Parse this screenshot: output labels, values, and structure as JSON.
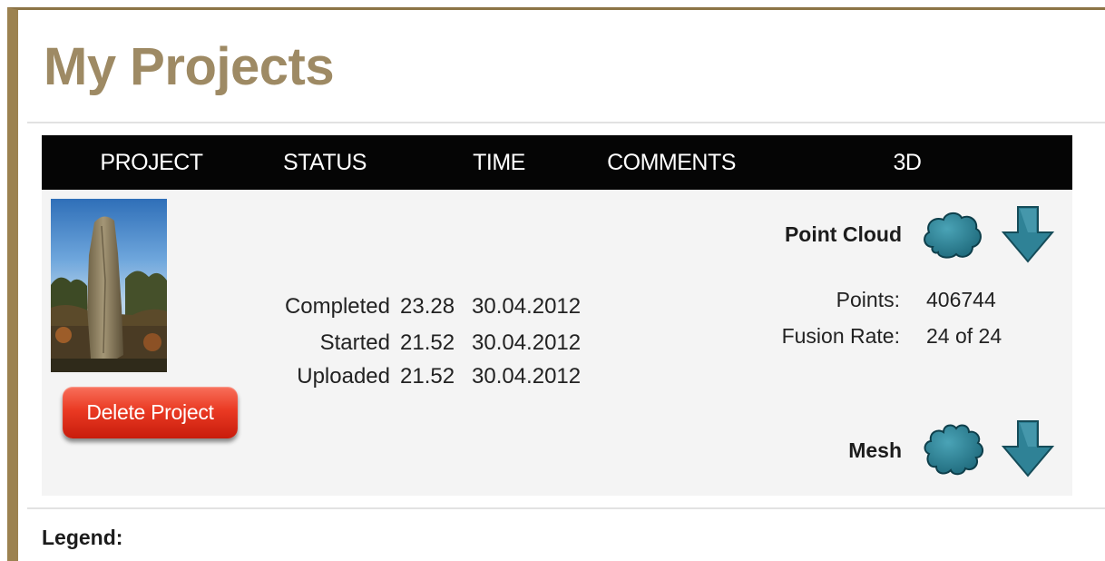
{
  "page": {
    "title": "My Projects",
    "legend_label": "Legend:"
  },
  "table": {
    "columns": [
      "PROJECT",
      "STATUS",
      "TIME",
      "COMMENTS",
      "3D"
    ]
  },
  "project": {
    "delete_label": "Delete Project",
    "status": [
      {
        "label": "Completed",
        "time": "23.28",
        "date": "30.04.2012"
      },
      {
        "label": "Started",
        "time": "21.52",
        "date": "30.04.2012"
      },
      {
        "label": "Uploaded",
        "time": "21.52",
        "date": "30.04.2012"
      }
    ],
    "point_cloud": {
      "label": "Point Cloud",
      "points_label": "Points:",
      "points_value": "406744",
      "fusion_label": "Fusion Rate:",
      "fusion_value": "24 of 24"
    },
    "mesh": {
      "label": "Mesh"
    }
  },
  "icons": {
    "point_cloud_icon": "point-cloud-icon",
    "mesh_icon": "mesh-icon",
    "download_icon": "download-arrow-icon"
  },
  "colors": {
    "title": "#9e8a64",
    "frame": "#9c8250",
    "header_bg": "#050505",
    "delete_button": "#e33a22",
    "icon_teal": "#2e8294"
  }
}
